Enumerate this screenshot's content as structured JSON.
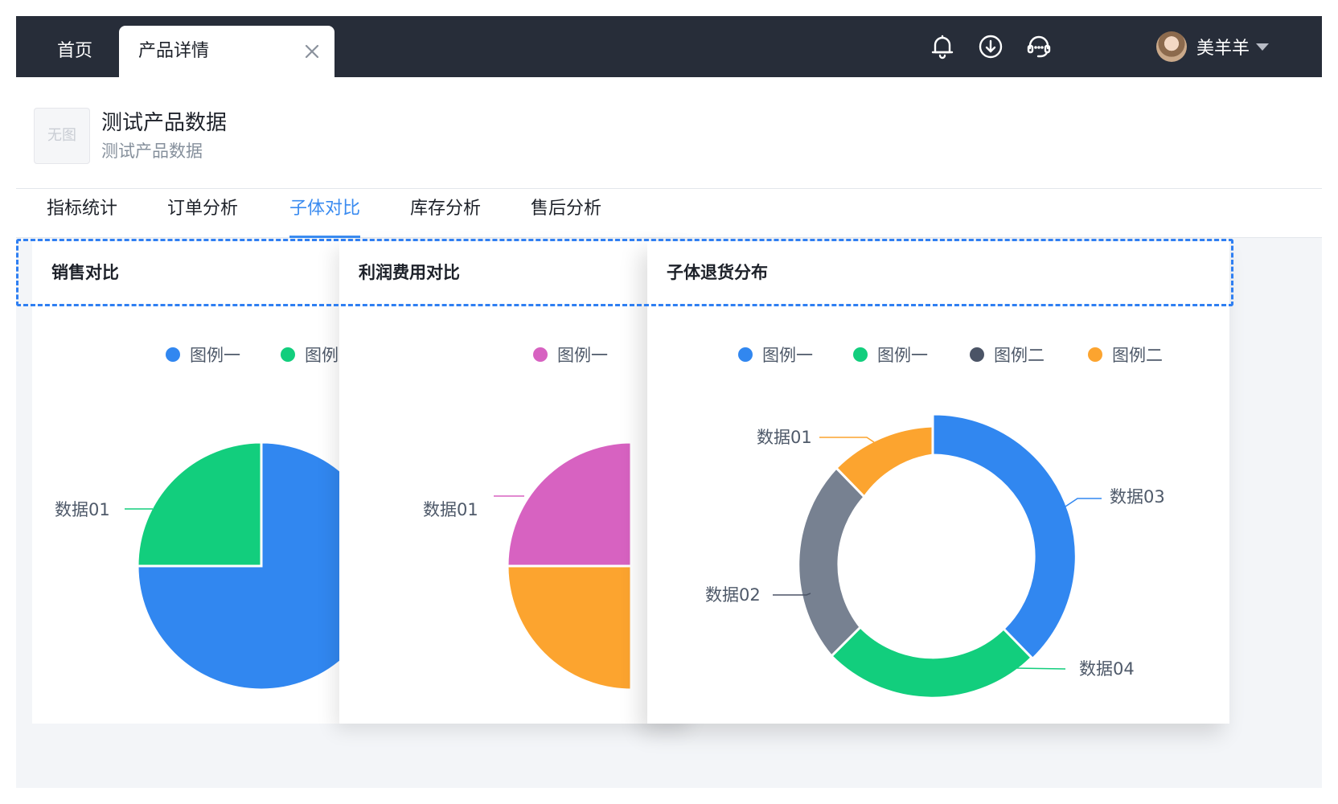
{
  "topbar": {
    "home_tab": "首页",
    "active_tab": "产品详情",
    "icons": [
      "bell-icon",
      "download-icon",
      "support-icon"
    ],
    "username": "美羊羊"
  },
  "product": {
    "thumbnail_text": "无图",
    "name": "测试产品数据",
    "subtitle": "测试产品数据"
  },
  "subtabs": [
    {
      "label": "指标统计",
      "active": false
    },
    {
      "label": "订单分析",
      "active": false
    },
    {
      "label": "子体对比",
      "active": true
    },
    {
      "label": "库存分析",
      "active": false
    },
    {
      "label": "售后分析",
      "active": false
    }
  ],
  "colors": {
    "accent": "#3a8bf0",
    "blue": "#3187f0",
    "green": "#12ce7d",
    "gray": "#778191",
    "orange": "#fca42f",
    "pink": "#d762c1",
    "legend_gray": "#4b5466"
  },
  "chart_data": [
    {
      "type": "pie",
      "title": "销售对比",
      "legend": [
        {
          "name": "图例一",
          "color": "#3187f0"
        },
        {
          "name": "图例",
          "color": "#12ce7d"
        }
      ],
      "slices": [
        {
          "label": "数据01",
          "value": 25,
          "color": "#12ce7d"
        },
        {
          "label": "",
          "value": 75,
          "color": "#3187f0"
        }
      ]
    },
    {
      "type": "pie",
      "title": "利润费用对比",
      "legend": [
        {
          "name": "图例一",
          "color": "#d762c1"
        }
      ],
      "slices": [
        {
          "label": "数据01",
          "value": 25,
          "color": "#d762c1"
        },
        {
          "label": "",
          "value": 25,
          "color": "#fca42f"
        }
      ]
    },
    {
      "type": "pie",
      "title": "子体退货分布",
      "legend": [
        {
          "name": "图例一",
          "color": "#3187f0"
        },
        {
          "name": "图例一",
          "color": "#12ce7d"
        },
        {
          "name": "图例二",
          "color": "#4b5466"
        },
        {
          "name": "图例二",
          "color": "#fca42f"
        }
      ],
      "slices": [
        {
          "label": "数据03",
          "value": 38,
          "color": "#3187f0"
        },
        {
          "label": "数据04",
          "value": 25,
          "color": "#12ce7d"
        },
        {
          "label": "数据02",
          "value": 24,
          "color": "#778191"
        },
        {
          "label": "数据01",
          "value": 13,
          "color": "#fca42f"
        }
      ]
    }
  ]
}
